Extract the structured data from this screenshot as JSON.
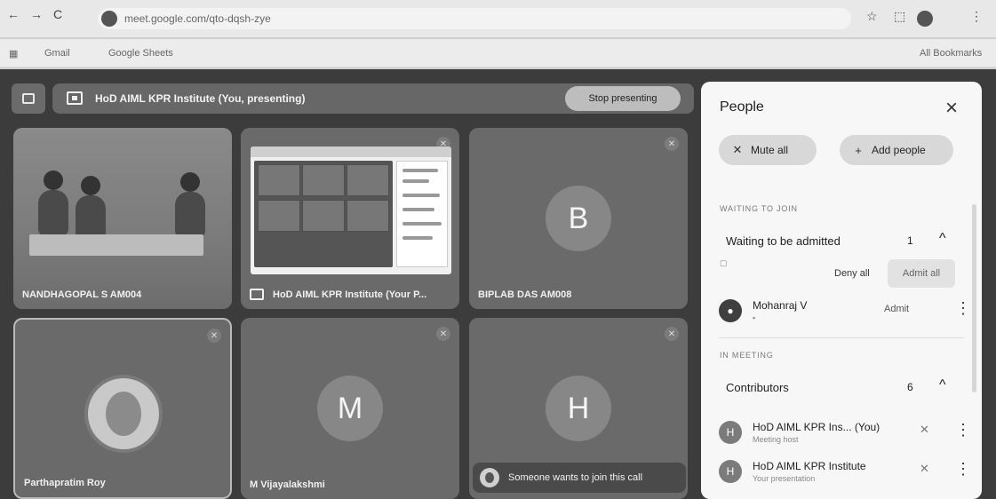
{
  "browser": {
    "url": "meet.google.com/qto-dqsh-zye",
    "bookmarks": [
      "Gmail",
      "Google Sheets"
    ],
    "bookmarks_all": "All Bookmarks"
  },
  "meet": {
    "presenting_label": "HoD AIML KPR Institute (You, presenting)",
    "stop_presenting": "Stop presenting",
    "tiles": [
      {
        "name": "NANDHAGOPAL S AM004",
        "kind": "photo"
      },
      {
        "name": "HoD AIML KPR Institute (Your P...",
        "kind": "screen"
      },
      {
        "name": "BIPLAB DAS AM008",
        "initial": "B",
        "kind": "initial"
      },
      {
        "name": "Parthapratim Roy",
        "kind": "avatar"
      },
      {
        "name": "M Vijayalakshmi",
        "initial": "M",
        "kind": "initial"
      },
      {
        "name": "",
        "initial": "H",
        "kind": "initial"
      }
    ],
    "join_banner": "Someone wants to join this call"
  },
  "panel": {
    "title": "People",
    "mute_all": "Mute all",
    "add_people": "Add people",
    "waiting_section": "WAITING TO JOIN",
    "waiting_label": "Waiting to be admitted",
    "waiting_count": "1",
    "deny_all": "Deny all",
    "admit_all": "Admit all",
    "waiting_person": {
      "name": "Mohanraj V",
      "admit": "Admit"
    },
    "meeting_section": "IN MEETING",
    "contributors_label": "Contributors",
    "contributors_count": "6",
    "people": [
      {
        "name": "HoD AIML KPR Ins... (You)",
        "sub": "Meeting host",
        "initial": "H"
      },
      {
        "name": "HoD AIML KPR Institute",
        "sub": "Your presentation",
        "initial": "H"
      }
    ]
  }
}
